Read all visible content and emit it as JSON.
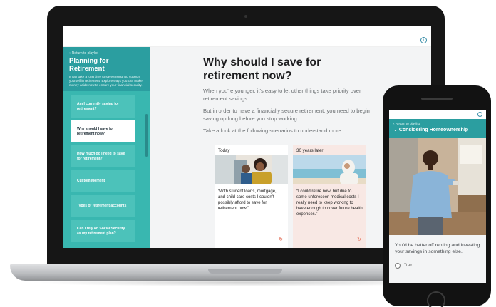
{
  "laptop": {
    "sidebar": {
      "back_label": "Return to playlist",
      "title": "Planning for Retirement",
      "description": "It can take a long time to save enough to support yourself in retirement. Explore ways you can make money aside now to ensure your financial security.",
      "items": [
        {
          "label": "Am I currently saving for retirement?",
          "active": false
        },
        {
          "label": "Why should I save for retirement now?",
          "active": true
        },
        {
          "label": "How much do I need to save for retirement?",
          "active": false
        },
        {
          "label": "Custom Moment",
          "active": false
        },
        {
          "label": "Types of retirement accounts",
          "active": false
        },
        {
          "label": "Can I rely on Social Security as my retirement plan?",
          "active": false
        }
      ]
    },
    "main": {
      "heading": "Why should I save for retirement now?",
      "paragraphs": [
        "When you're younger, it's easy to let other things take priority over retirement savings.",
        "But in order to have a financially secure retirement, you need to begin saving up long before you stop working.",
        "Take a look at the following scenarios to understand more."
      ],
      "cards": [
        {
          "label": "Today",
          "quote": "“With student loans, mortgage, and child care costs I couldn’t possibly afford to save for retirement now.”"
        },
        {
          "label": "30 years later",
          "quote": "“I could retire now, but due to some unforeseen medical costs I really need to keep working to have enough to cover future health expenses.”"
        }
      ]
    }
  },
  "phone": {
    "back_label": "Return to playlist",
    "title": "Considering Homeownership",
    "body": "You’d be better off renting and investing your savings in something else.",
    "option_label": "True"
  },
  "colors": {
    "teal": "#39b7b0",
    "teal_dark": "#2b9ea0",
    "accent_orange": "#e0624a"
  }
}
